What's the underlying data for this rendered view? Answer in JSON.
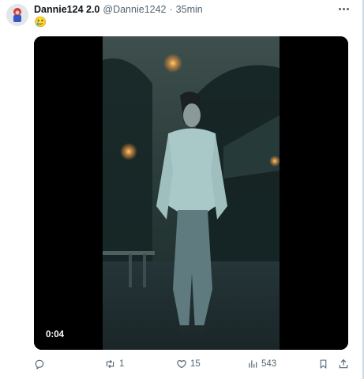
{
  "author": {
    "name": "Dannie124 2.0",
    "handle": "@Dannie1242",
    "separator": "·",
    "time": "35min"
  },
  "post": {
    "text": "🥲"
  },
  "media": {
    "duration": "0:04"
  },
  "actions": {
    "retweets": "1",
    "likes": "15",
    "views": "543"
  },
  "colors": {
    "text_primary": "#0f1419",
    "text_secondary": "#536471",
    "background": "#ffffff"
  },
  "icons": [
    "more-icon",
    "reply-icon",
    "retweet-icon",
    "like-icon",
    "views-icon",
    "bookmark-icon",
    "share-icon"
  ]
}
